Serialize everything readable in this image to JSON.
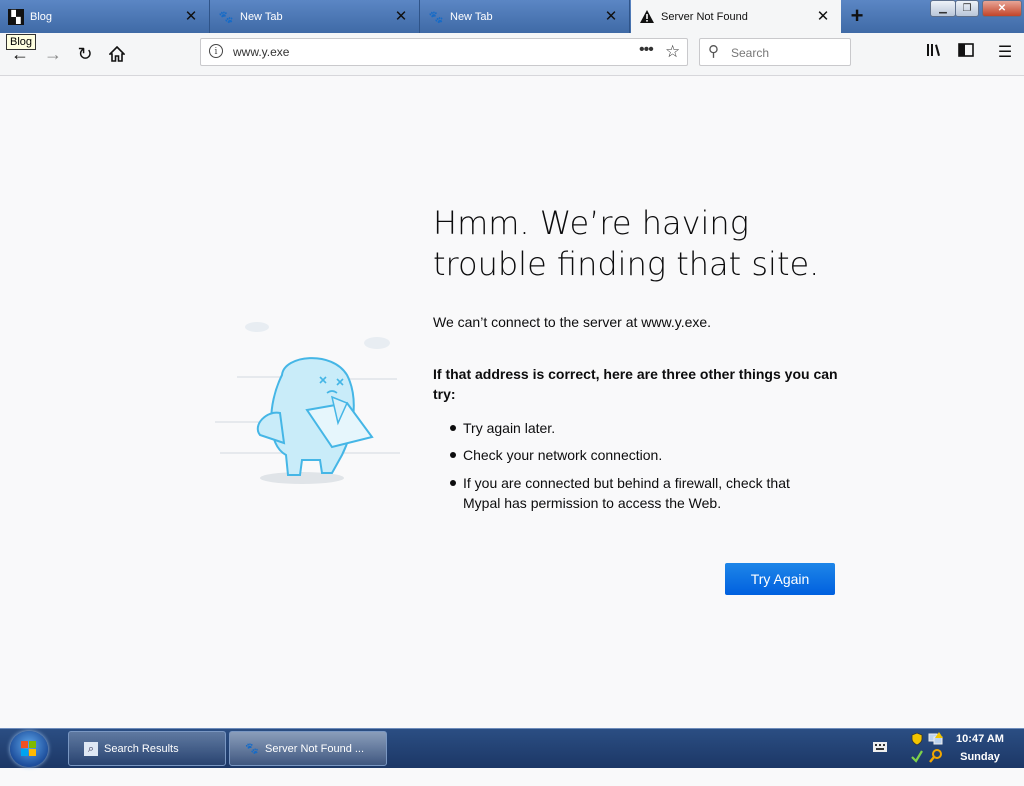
{
  "tabs": [
    {
      "label": "Blog",
      "icon": "blog-favicon",
      "close": "✕"
    },
    {
      "label": "New Tab",
      "icon": "mypal-favicon",
      "close": "✕"
    },
    {
      "label": "New Tab",
      "icon": "mypal-favicon",
      "close": "✕"
    },
    {
      "label": "Server Not Found",
      "icon": "warning-icon",
      "close": "✕"
    }
  ],
  "tooltip": "Blog",
  "navbar": {
    "url": "www.y.exe",
    "search_placeholder": "Search"
  },
  "error": {
    "title": "Hmm. We’re having trouble finding that site.",
    "description": "We can’t connect to the server at www.y.exe.",
    "heading": "If that address is correct, here are three other things you can try:",
    "suggestions": [
      "Try again later.",
      "Check your network connection.",
      "If you are connected but behind a firewall, check that Mypal has permission to access the Web."
    ],
    "button": "Try Again"
  },
  "taskbar": {
    "items": [
      {
        "label": "Search Results",
        "icon": "search-results-icon"
      },
      {
        "label": "Server Not Found ...",
        "icon": "mypal-icon"
      }
    ],
    "time": "10:47 AM",
    "day": "Sunday"
  },
  "colors": {
    "accent": "#0a84ff",
    "tabstrip": "#4a78b4",
    "page_bg": "#f9f9fa"
  }
}
